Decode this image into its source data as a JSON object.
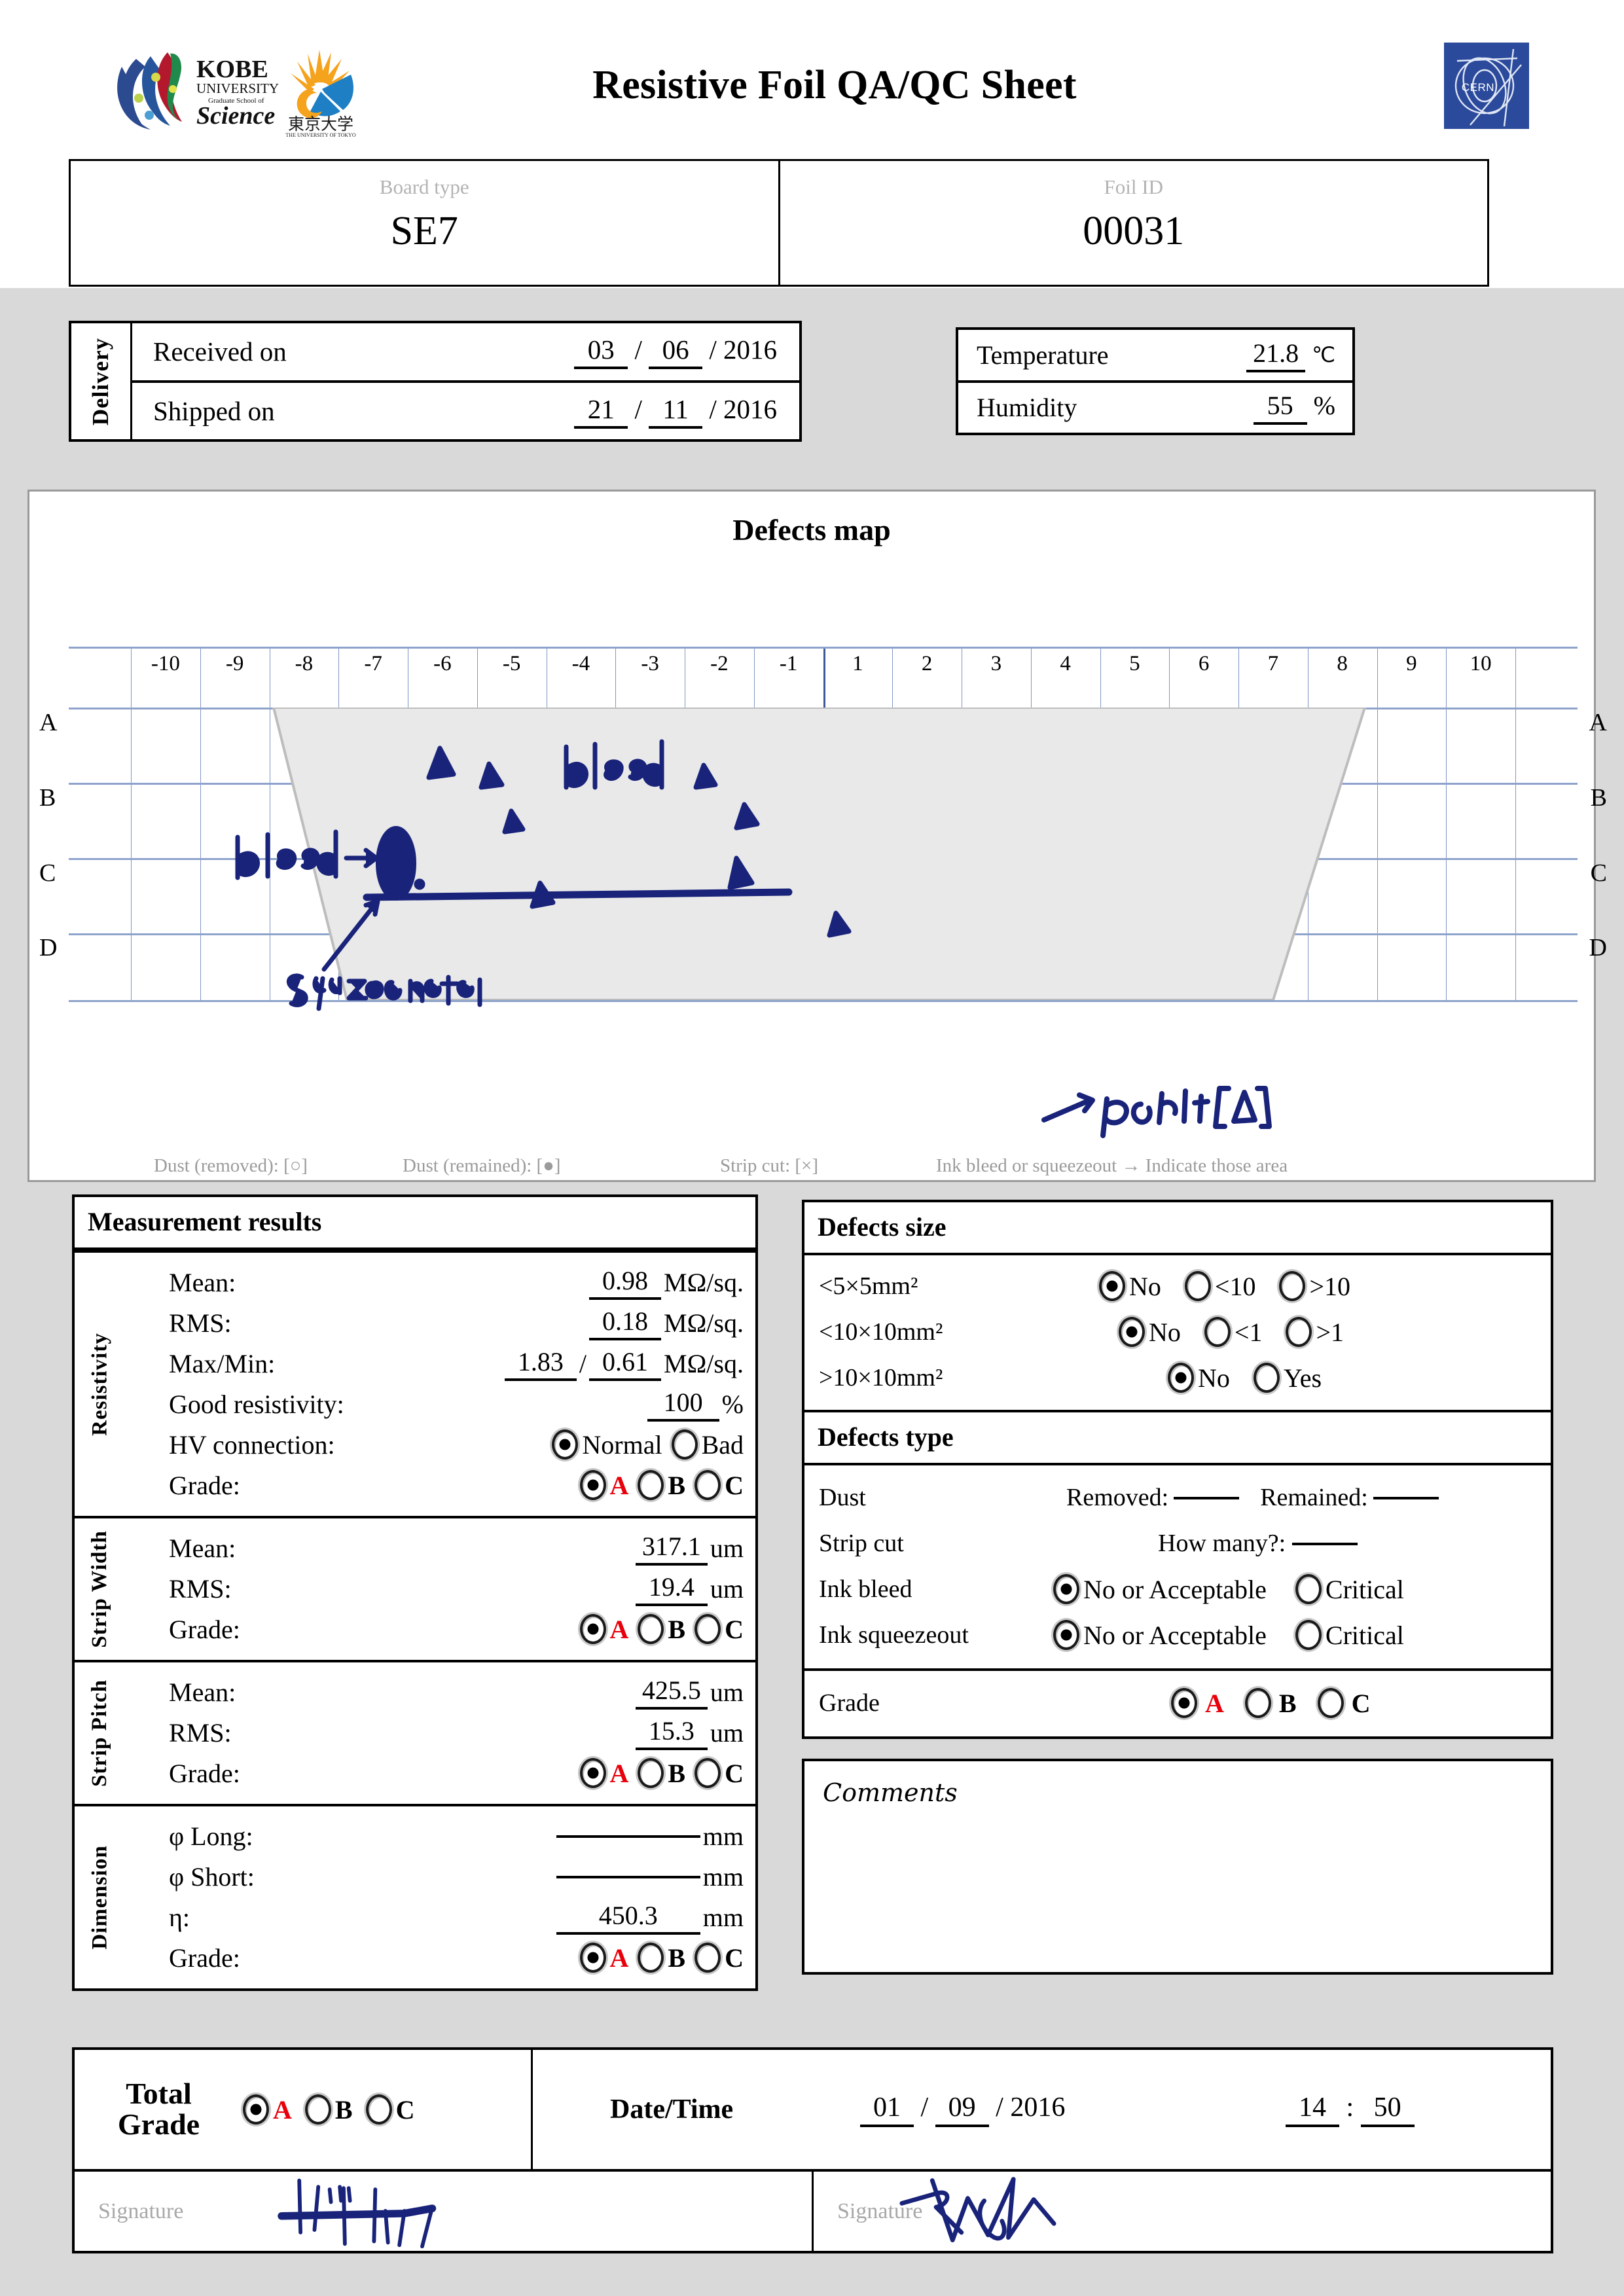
{
  "header": {
    "title": "Resistive Foil QA/QC Sheet",
    "logos": {
      "kobe": "kobe-university-logo",
      "utokyo": "university-of-tokyo-logo",
      "cern": "CERN"
    }
  },
  "identification": {
    "board_type_label": "Board type",
    "board_type_value": "SE7",
    "foil_id_label": "Foil ID",
    "foil_id_value": "00031"
  },
  "delivery": {
    "side_label": "Delivery",
    "received": {
      "label": "Received on",
      "day": "03",
      "month": "06",
      "year": "2016"
    },
    "shipped": {
      "label": "Shipped on",
      "day": "21",
      "month": "11",
      "year": "2016"
    }
  },
  "environment": {
    "temperature_label": "Temperature",
    "temperature_value": "21.8",
    "temperature_unit": "℃",
    "humidity_label": "Humidity",
    "humidity_value": "55",
    "humidity_unit": "%"
  },
  "defects_map": {
    "title": "Defects map",
    "columns": [
      "-10",
      "-9",
      "-8",
      "-7",
      "-6",
      "-5",
      "-4",
      "-3",
      "-2",
      "-1",
      "1",
      "2",
      "3",
      "4",
      "5",
      "6",
      "7",
      "8",
      "9",
      "10"
    ],
    "rows": [
      "A",
      "B",
      "C",
      "D"
    ],
    "legend": [
      "Dust (removed): [○]",
      "Dust (remained): [●]",
      "Strip cut: [×]",
      "Ink bleed or squeezeout → Indicate those area"
    ],
    "annotations": [
      {
        "text": "bleed→",
        "kind": "handwriting"
      },
      {
        "text": "bleed",
        "kind": "handwriting"
      },
      {
        "text": "squeezeout",
        "kind": "handwriting"
      },
      {
        "text": "→ point [Δ]",
        "kind": "handwriting"
      }
    ]
  },
  "measurement": {
    "title": "Measurement results",
    "resistivity": {
      "side_label": "Resistivity",
      "mean_label": "Mean:",
      "mean_value": "0.98",
      "mean_unit": "MΩ/sq.",
      "rms_label": "RMS:",
      "rms_value": "0.18",
      "rms_unit": "MΩ/sq.",
      "maxmin_label": "Max/Min:",
      "max_value": "1.83",
      "min_value": "0.61",
      "maxmin_unit": "MΩ/sq.",
      "good_label": "Good resistivity:",
      "good_value": "100",
      "good_unit": "%",
      "hv_label": "HV connection:",
      "hv_options": [
        "Normal",
        "Bad"
      ],
      "hv_selected": "Normal",
      "grade_label": "Grade:",
      "grade_options": [
        "A",
        "B",
        "C"
      ],
      "grade_selected": "A"
    },
    "strip_width": {
      "side_label": "Strip Width",
      "mean_label": "Mean:",
      "mean_value": "317.1",
      "mean_unit": "um",
      "rms_label": "RMS:",
      "rms_value": "19.4",
      "rms_unit": "um",
      "grade_label": "Grade:",
      "grade_selected": "A"
    },
    "strip_pitch": {
      "side_label": "Strip Pitch",
      "mean_label": "Mean:",
      "mean_value": "425.5",
      "mean_unit": "um",
      "rms_label": "RMS:",
      "rms_value": "15.3",
      "rms_unit": "um",
      "grade_label": "Grade:",
      "grade_selected": "A"
    },
    "dimension": {
      "side_label": "Dimension",
      "long_label": "φ Long:",
      "long_value": "",
      "long_unit": "mm",
      "short_label": "φ Short:",
      "short_value": "",
      "short_unit": "mm",
      "eta_label": "η:",
      "eta_value": "450.3",
      "eta_unit": "mm",
      "grade_label": "Grade:",
      "grade_selected": "A"
    }
  },
  "defects_size": {
    "title": "Defects size",
    "rows": [
      {
        "label": "<5×5mm²",
        "options": [
          "No",
          "<10",
          ">10"
        ],
        "selected": "No"
      },
      {
        "label": "<10×10mm²",
        "options": [
          "No",
          "<1",
          ">1"
        ],
        "selected": "No"
      },
      {
        "label": ">10×10mm²",
        "options": [
          "No",
          "Yes"
        ],
        "selected": "No"
      }
    ]
  },
  "defects_type": {
    "title": "Defects type",
    "dust_label": "Dust",
    "dust_removed_label": "Removed:",
    "dust_removed_value": "",
    "dust_remained_label": "Remained:",
    "dust_remained_value": "",
    "strip_cut_label": "Strip cut",
    "strip_cut_howmany_label": "How many?:",
    "strip_cut_howmany_value": "",
    "ink_bleed_label": "Ink bleed",
    "ink_bleed_options": [
      "No or Acceptable",
      "Critical"
    ],
    "ink_bleed_selected": "No or Acceptable",
    "ink_squeezeout_label": "Ink squeezeout",
    "ink_squeezeout_options": [
      "No or Acceptable",
      "Critical"
    ],
    "ink_squeezeout_selected": "No or Acceptable",
    "grade_label": "Grade",
    "grade_options": [
      "A",
      "B",
      "C"
    ],
    "grade_selected": "A"
  },
  "comments": {
    "title": "Comments",
    "value": ""
  },
  "total": {
    "grade_label_line1": "Total",
    "grade_label_line2": "Grade",
    "grade_options": [
      "A",
      "B",
      "C"
    ],
    "grade_selected": "A",
    "datetime_label": "Date/Time",
    "day": "01",
    "month": "09",
    "year": "2016",
    "hour": "14",
    "minute": "50",
    "signature_label_left": "Signature",
    "signature_label_right": "Signature"
  },
  "colors": {
    "grade_selected": "#e8000b",
    "ink": "#19237a",
    "page_band": "#d9d9d9",
    "grid_line": "#7f96c4",
    "grid_mid": "#3c5a96",
    "foil_fill": "#e9e9e9",
    "cern_blue": "#2b4a9b"
  }
}
